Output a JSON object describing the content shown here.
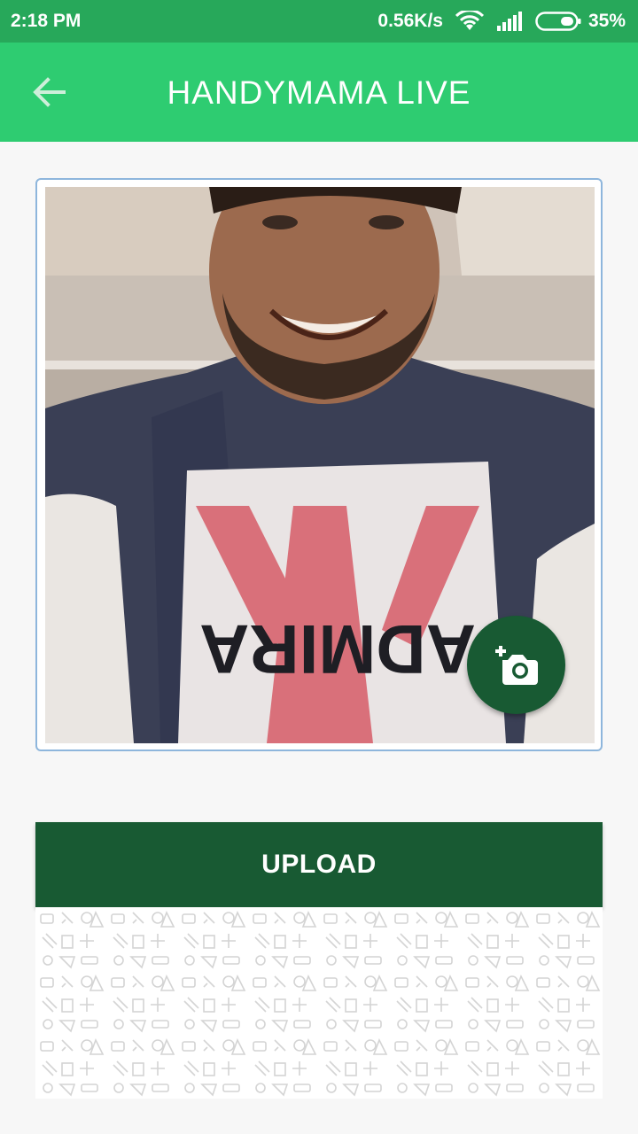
{
  "status_bar": {
    "time": "2:18 PM",
    "network_speed": "0.56K/s",
    "battery_percent": "35%",
    "icons": [
      "wifi-icon",
      "signal-icon",
      "battery-icon"
    ]
  },
  "app_bar": {
    "title": "HANDYMAMA LIVE",
    "back_icon": "arrow-left-icon"
  },
  "photo": {
    "shirt_text": "ADMIRA"
  },
  "fab": {
    "icon": "add-a-photo-icon"
  },
  "upload": {
    "label": "UPLOAD"
  },
  "colors": {
    "status_bar": "#27a85a",
    "app_bar": "#2ecc71",
    "dark_green": "#185a33",
    "card_border": "#8eb6dc"
  }
}
